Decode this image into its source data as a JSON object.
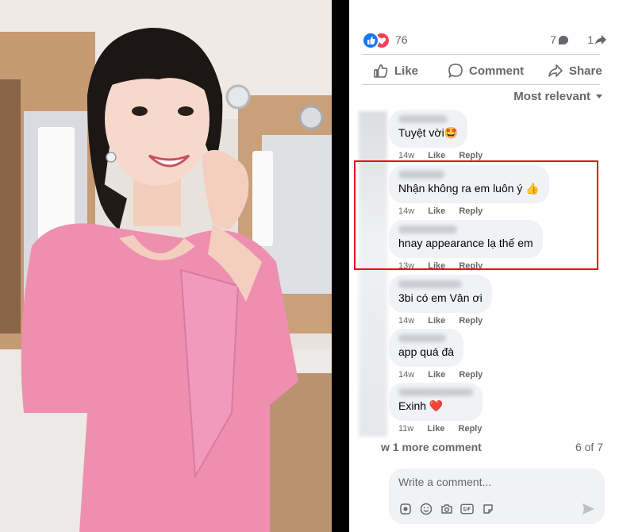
{
  "colors": {
    "brand_blue": "#1877f2",
    "love_red": "#f33e58",
    "muted_text": "#65676b",
    "bubble_bg": "#f0f2f5",
    "highlight_red": "#e0151b",
    "dress_pink": "#ee8fb0"
  },
  "post": {
    "reaction_count": "76",
    "comment_count": "7",
    "share_count": "1",
    "reaction_icons": [
      "like-icon",
      "love-icon"
    ]
  },
  "actions": {
    "like": "Like",
    "comment": "Comment",
    "share": "Share"
  },
  "sort": {
    "label": "Most relevant"
  },
  "meta_labels": {
    "like": "Like",
    "reply": "Reply"
  },
  "comments": [
    {
      "text": "Tuyệt vời🤩",
      "time": "14w"
    },
    {
      "text": "Nhận không ra em luôn ý 👍",
      "time": "14w"
    },
    {
      "text": "hnay appearance lạ thế em",
      "time": "13w"
    },
    {
      "text": "3bi có em Vân ơi",
      "time": "14w"
    },
    {
      "text": "app quá đà",
      "time": "14w"
    },
    {
      "text": "Exinh ❤️",
      "time": "11w"
    }
  ],
  "footer": {
    "more_comments": "w 1 more comment",
    "page_count": "6 of 7",
    "write_placeholder": "Write a comment..."
  },
  "composer_icons": [
    "sticker-avatar-icon",
    "emoji-icon",
    "camera-icon",
    "gif-icon",
    "sticker-icon",
    "send-icon"
  ]
}
